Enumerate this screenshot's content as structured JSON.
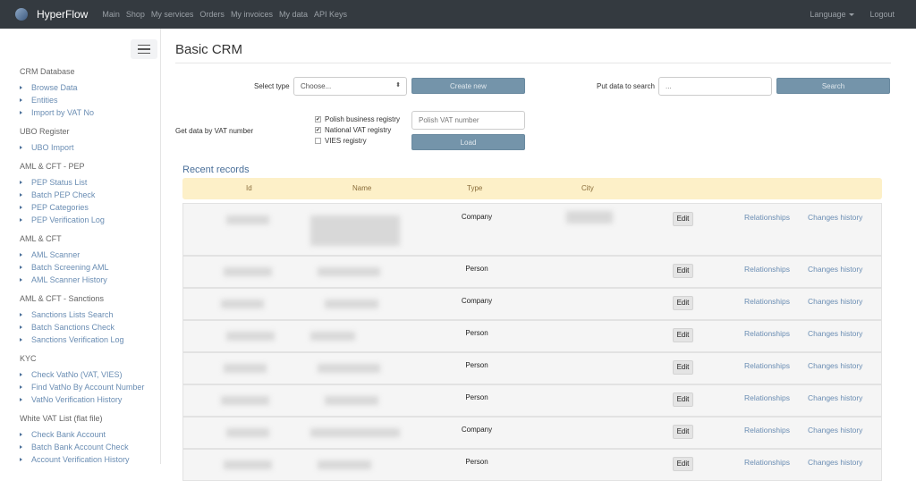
{
  "nav": {
    "brand": "HyperFlow",
    "links": [
      "Main",
      "Shop",
      "My services",
      "Orders",
      "My invoices",
      "My data",
      "API Keys"
    ],
    "language": "Language",
    "logout": "Logout"
  },
  "sidebar": [
    {
      "title": "CRM Database",
      "items": [
        "Browse Data",
        "Entities",
        "Import by VAT No"
      ]
    },
    {
      "title": "UBO Register",
      "items": [
        "UBO Import"
      ]
    },
    {
      "title": "AML & CFT - PEP",
      "items": [
        "PEP Status List",
        "Batch PEP Check",
        "PEP Categories",
        "PEP Verification Log"
      ]
    },
    {
      "title": "AML & CFT",
      "items": [
        "AML Scanner",
        "Batch Screening AML",
        "AML Scanner History"
      ]
    },
    {
      "title": "AML & CFT - Sanctions",
      "items": [
        "Sanctions Lists Search",
        "Batch Sanctions Check",
        "Sanctions Verification Log"
      ]
    },
    {
      "title": "KYC",
      "items": [
        "Check VatNo (VAT, VIES)",
        "Find VatNo By Account Number",
        "VatNo Verification History"
      ]
    },
    {
      "title": "White VAT List (flat file)",
      "items": [
        "Check Bank Account",
        "Batch Bank Account Check",
        "Account Verification History"
      ]
    }
  ],
  "main": {
    "title": "Basic CRM",
    "select_type_label": "Select type",
    "select_value": "Choose...",
    "create_new": "Create new",
    "search_label": "Put data to search",
    "search_value": "...",
    "search_button": "Search",
    "vat_label": "Get data by VAT number",
    "registries": [
      {
        "label": "Polish business registry",
        "checked": true
      },
      {
        "label": "National VAT registry",
        "checked": true
      },
      {
        "label": "VIES registry",
        "checked": false
      }
    ],
    "vat_placeholder": "Polish VAT number",
    "load": "Load"
  },
  "recent": {
    "title": "Recent records",
    "columns": [
      "Id",
      "Name",
      "Type",
      "City"
    ],
    "edit": "Edit",
    "relationships": "Relationships",
    "changes": "Changes history",
    "rows": [
      {
        "type": "Company"
      },
      {
        "type": "Person"
      },
      {
        "type": "Company"
      },
      {
        "type": "Person"
      },
      {
        "type": "Person"
      },
      {
        "type": "Person"
      },
      {
        "type": "Company"
      },
      {
        "type": "Person"
      }
    ]
  }
}
